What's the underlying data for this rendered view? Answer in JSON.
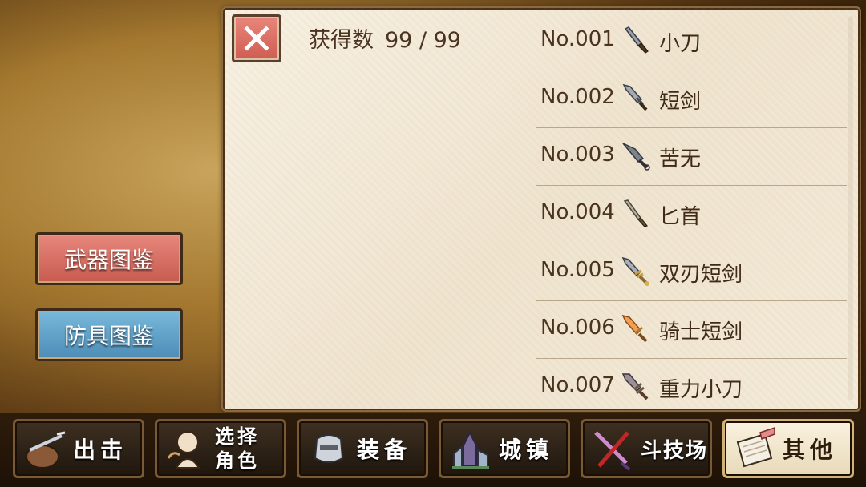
{
  "collection": {
    "count_label": "获得数",
    "count_value": "99 / 99"
  },
  "close_button": {
    "icon": "close-icon"
  },
  "side_buttons": {
    "weapons": "武器图鉴",
    "armor": "防具图鉴"
  },
  "items": [
    {
      "no": "No.001",
      "name": "小刀",
      "icon": "knife-icon",
      "color": "#7a7f8a"
    },
    {
      "no": "No.002",
      "name": "短剑",
      "icon": "short-sword-icon",
      "color": "#6d7380"
    },
    {
      "no": "No.003",
      "name": "苦无",
      "icon": "kunai-icon",
      "color": "#656a72"
    },
    {
      "no": "No.004",
      "name": "匕首",
      "icon": "dagger-icon",
      "color": "#8a8778"
    },
    {
      "no": "No.005",
      "name": "双刃短剑",
      "icon": "double-blade-icon",
      "color": "#8c7a55"
    },
    {
      "no": "No.006",
      "name": "骑士短剑",
      "icon": "knight-sword-icon",
      "color": "#e07a2a"
    },
    {
      "no": "No.007",
      "name": "重力小刀",
      "icon": "gravity-knife-icon",
      "color": "#7d6f78"
    }
  ],
  "tabs": [
    {
      "label": "出击",
      "icon": "sortie-icon"
    },
    {
      "label": "选择角色",
      "line1": "选择",
      "line2": "角色",
      "icon": "character-icon"
    },
    {
      "label": "装备",
      "icon": "equipment-icon"
    },
    {
      "label": "城镇",
      "icon": "town-icon"
    },
    {
      "label": "斗技场",
      "icon": "arena-icon"
    },
    {
      "label": "其他",
      "icon": "other-icon",
      "active": true
    }
  ],
  "colors": {
    "close": "#d9655a",
    "weapon_btn": "#d96b60",
    "armor_btn": "#5f9ec8",
    "panel": "#f3ead8",
    "text": "#4a3420"
  }
}
